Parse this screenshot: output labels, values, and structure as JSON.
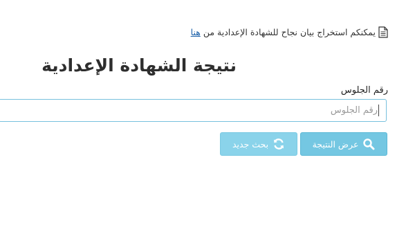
{
  "notice": {
    "text": "يمكنكم استخراج بيان نجاح للشهادة الإعدادية من",
    "link": "هنا",
    "icon": "document-icon"
  },
  "title": "نتيجة الشهادة الإعدادية",
  "seat_field": {
    "label": "رقم الجلوس",
    "placeholder": "رقم الجلوس",
    "value": ""
  },
  "buttons": {
    "show_result": {
      "label": "عرض النتيجة",
      "icon": "search-icon"
    },
    "new_search": {
      "label": "بحث جديد",
      "icon": "refresh-icon"
    }
  },
  "colors": {
    "button_primary": "#74c7e2",
    "button_secondary": "#8ad3ea",
    "input_border": "#77c0dd",
    "link": "#1a5fa8"
  }
}
